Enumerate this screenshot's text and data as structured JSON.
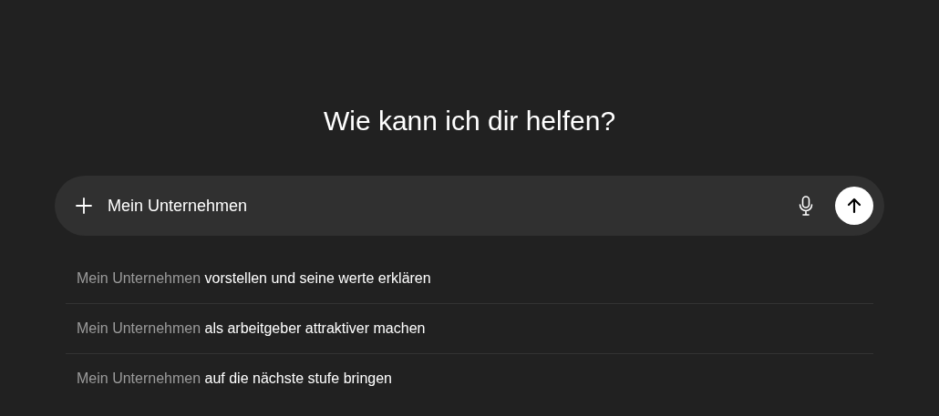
{
  "heading": "Wie kann ich dir helfen?",
  "composer": {
    "value": "Mein Unternehmen"
  },
  "suggestions": [
    {
      "prefix": "Mein Unternehmen",
      "completion": "vorstellen und seine werte erklären"
    },
    {
      "prefix": "Mein Unternehmen",
      "completion": "als arbeitgeber attraktiver machen"
    },
    {
      "prefix": "Mein Unternehmen",
      "completion": "auf die nächste stufe bringen"
    }
  ]
}
